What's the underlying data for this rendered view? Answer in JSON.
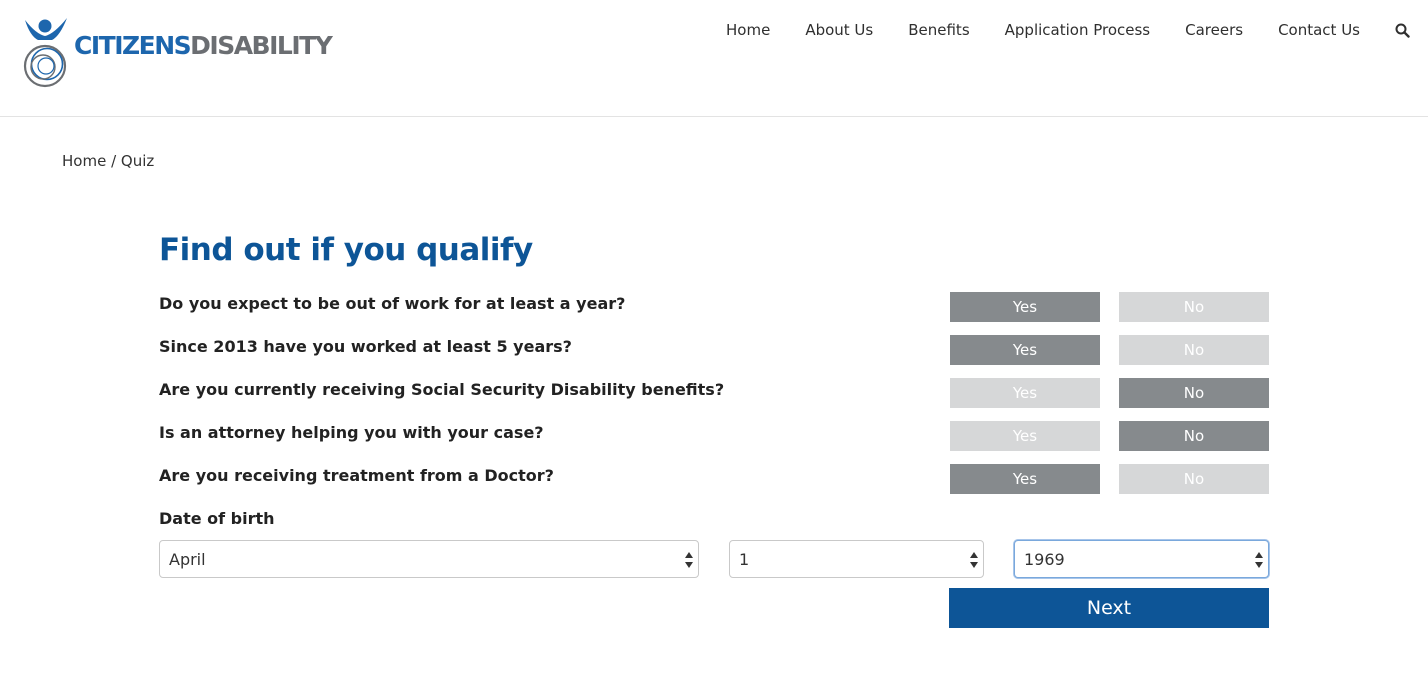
{
  "header": {
    "logo": {
      "text_part1": "CITIZENS",
      "text_part2": "DISABILITY"
    },
    "nav": [
      {
        "label": "Home"
      },
      {
        "label": "About Us"
      },
      {
        "label": "Benefits"
      },
      {
        "label": "Application Process"
      },
      {
        "label": "Careers"
      },
      {
        "label": "Contact Us"
      }
    ],
    "search_icon": "search-icon"
  },
  "breadcrumb": {
    "home": "Home",
    "separator": " / ",
    "current": "Quiz"
  },
  "quiz": {
    "title": "Find out if you qualify",
    "yes_label": "Yes",
    "no_label": "No",
    "questions": [
      {
        "text": "Do you expect to be out of work for at least a year?",
        "answer": "yes"
      },
      {
        "text": "Since 2013 have you worked at least 5 years?",
        "answer": "yes"
      },
      {
        "text": "Are you currently receiving Social Security Disability benefits?",
        "answer": "no"
      },
      {
        "text": "Is an attorney helping you with your case?",
        "answer": "no"
      },
      {
        "text": "Are you receiving treatment from a Doctor?",
        "answer": "yes"
      }
    ],
    "dob": {
      "label": "Date of birth",
      "month": "April",
      "day": "1",
      "year": "1969"
    },
    "next_label": "Next"
  },
  "colors": {
    "brand_blue": "#0d5597",
    "logo_blue": "#1d66ad",
    "logo_gray": "#6b6e72",
    "selected": "#868a8d",
    "unselected": "#d6d7d8"
  }
}
